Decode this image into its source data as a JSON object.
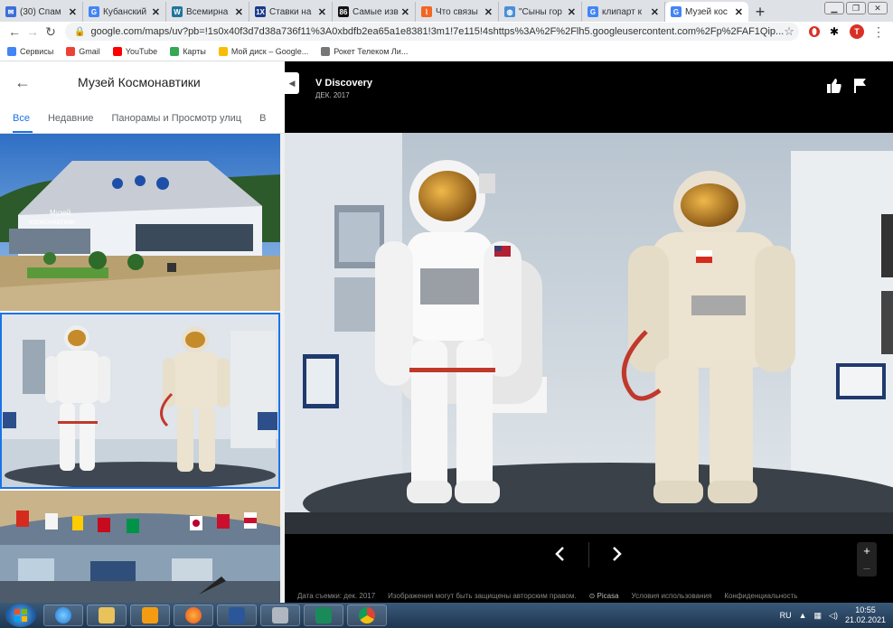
{
  "browser": {
    "tabs": [
      {
        "title": "(30) Спам",
        "fav_color": "#3b6fd8",
        "fav_glyph": "✉"
      },
      {
        "title": "Кубанский",
        "fav_color": "#4285f4",
        "fav_glyph": "G"
      },
      {
        "title": "Всемирна",
        "fav_color": "#21759b",
        "fav_glyph": "W"
      },
      {
        "title": "Ставки на",
        "fav_color": "#1b3a8a",
        "fav_glyph": "1X"
      },
      {
        "title": "Самые изв",
        "fav_color": "#111111",
        "fav_glyph": "86"
      },
      {
        "title": "Что связы",
        "fav_color": "#f26522",
        "fav_glyph": "⌇"
      },
      {
        "title": "\"Сыны гор",
        "fav_color": "#4a8fd8",
        "fav_glyph": "◍"
      },
      {
        "title": "клипарт к",
        "fav_color": "#4285f4",
        "fav_glyph": "G"
      },
      {
        "title": "Музей кос",
        "fav_color": "#4285f4",
        "fav_glyph": "G"
      }
    ],
    "new_tab": "+",
    "url": "google.com/maps/uv?pb=!1s0x40f3d7d38a736f11%3A0xbdfb2ea65a1e8381!3m1!7e115!4shttps%3A%2F%2Flh5.googleusercontent.com%2Fp%2FAF1Qip...",
    "profile_initial": "T",
    "bookmarks": [
      {
        "label": "Сервисы",
        "color": "#4285f4"
      },
      {
        "label": "Gmail",
        "color": "#ea4335"
      },
      {
        "label": "YouTube",
        "color": "#ff0000"
      },
      {
        "label": "Карты",
        "color": "#34a853"
      },
      {
        "label": "Мой диск – Google...",
        "color": "#fbbc05"
      },
      {
        "label": "Рокет Телеком Ли...",
        "color": "#777777"
      }
    ]
  },
  "panel": {
    "title": "Музей Космонавтики",
    "tabs": [
      "Все",
      "Недавние",
      "Панорамы и Просмотр улиц",
      "В"
    ],
    "building_text_1": "Музей",
    "building_text_2": "космонавтики"
  },
  "viewer": {
    "title": "V Discovery",
    "date": "ДЕК. 2017",
    "footer": {
      "date_label": "Дата съемки: дек. 2017",
      "copyright": "Изображения могут быть защищены авторским правом.",
      "picasa": "Picasa",
      "terms": "Условия использования",
      "privacy": "Конфиденциальность"
    },
    "zoom_in": "+",
    "zoom_out": "–"
  },
  "taskbar": {
    "lang": "RU",
    "time": "10:55",
    "date": "21.02.2021"
  }
}
